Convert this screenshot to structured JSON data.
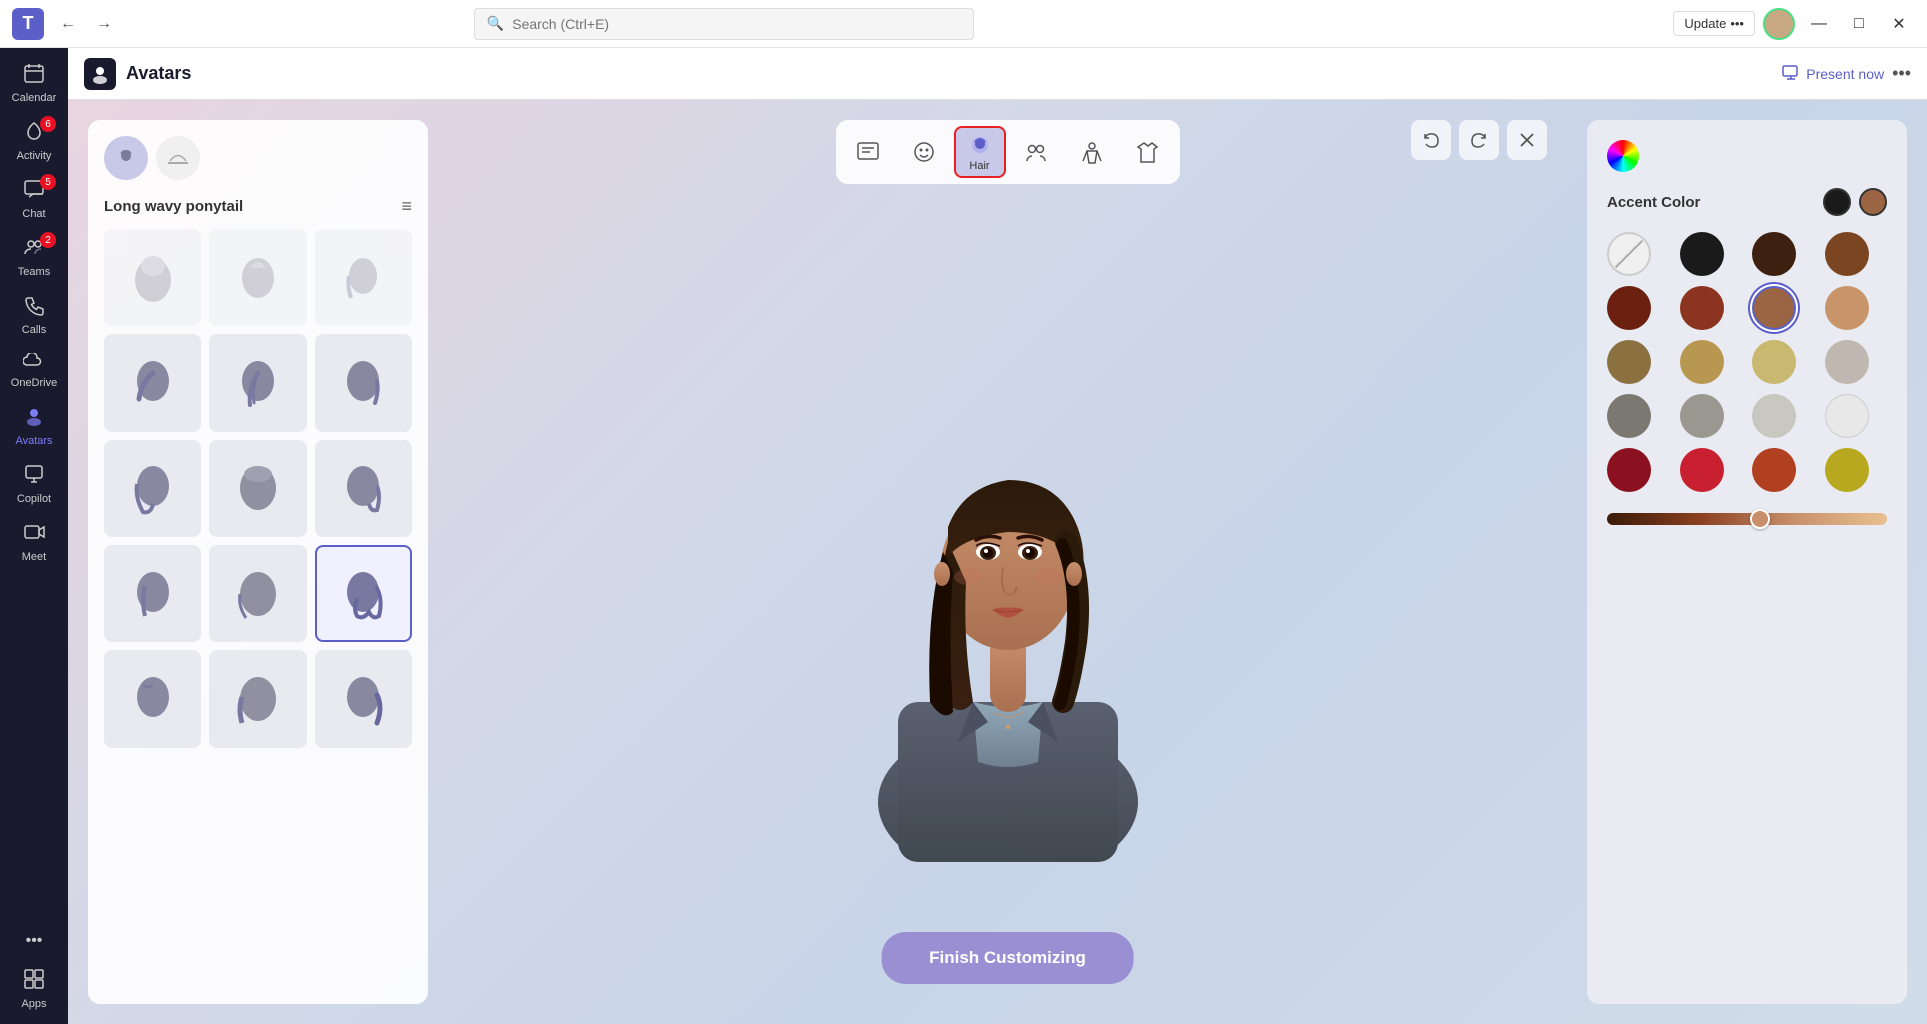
{
  "titlebar": {
    "app_icon": "🟦",
    "back_label": "←",
    "forward_label": "→",
    "search_placeholder": "Search (Ctrl+E)",
    "update_label": "Update",
    "update_dots": "•••",
    "minimize_label": "—",
    "maximize_label": "□",
    "close_label": "✕"
  },
  "sidebar": {
    "items": [
      {
        "id": "calendar",
        "label": "Calendar",
        "icon": "📅",
        "badge": null,
        "active": false
      },
      {
        "id": "activity",
        "label": "Activity",
        "icon": "🔔",
        "badge": "6",
        "active": false
      },
      {
        "id": "chat",
        "label": "Chat",
        "icon": "💬",
        "badge": "5",
        "active": false
      },
      {
        "id": "teams",
        "label": "Teams",
        "icon": "👥",
        "badge": "2",
        "active": false
      },
      {
        "id": "calls",
        "label": "Calls",
        "icon": "📞",
        "badge": null,
        "active": false
      },
      {
        "id": "onedrive",
        "label": "OneDrive",
        "icon": "☁",
        "badge": null,
        "active": false
      },
      {
        "id": "avatars",
        "label": "Avatars",
        "icon": "🧑",
        "badge": null,
        "active": true
      },
      {
        "id": "copilot",
        "label": "Copilot",
        "icon": "🤖",
        "badge": null,
        "active": false
      },
      {
        "id": "meet",
        "label": "Meet",
        "icon": "📹",
        "badge": null,
        "active": false
      },
      {
        "id": "more",
        "label": "•••",
        "icon": "•••",
        "badge": null,
        "active": false
      },
      {
        "id": "apps",
        "label": "Apps",
        "icon": "⊞",
        "badge": null,
        "active": false
      }
    ]
  },
  "page_header": {
    "icon": "🧑",
    "title": "Avatars",
    "present_now_label": "Present now",
    "more_label": "•••"
  },
  "toolbar": {
    "buttons": [
      {
        "id": "reactions",
        "icon": "📋",
        "label": "",
        "active": false
      },
      {
        "id": "face",
        "icon": "😊",
        "label": "",
        "active": false
      },
      {
        "id": "hair",
        "icon": "🧑",
        "label": "Hair",
        "active": true,
        "selected": true
      },
      {
        "id": "groups",
        "icon": "👥",
        "label": "",
        "active": false
      },
      {
        "id": "body",
        "icon": "🤸",
        "label": "",
        "active": false
      },
      {
        "id": "clothes",
        "icon": "👕",
        "label": "",
        "active": false
      }
    ]
  },
  "controls": {
    "undo_label": "↩",
    "redo_label": "↪",
    "close_label": "✕"
  },
  "hair_panel": {
    "tabs": [
      {
        "id": "hair-style",
        "icon": "🧑",
        "active": true
      },
      {
        "id": "hat",
        "icon": "🎩",
        "active": false
      }
    ],
    "title": "Long wavy ponytail",
    "filter_icon": "≡",
    "styles": [
      {
        "id": 1,
        "selected": false,
        "row": 0
      },
      {
        "id": 2,
        "selected": false,
        "row": 0
      },
      {
        "id": 3,
        "selected": false,
        "row": 0
      },
      {
        "id": 4,
        "selected": false,
        "row": 1
      },
      {
        "id": 5,
        "selected": false,
        "row": 1
      },
      {
        "id": 6,
        "selected": false,
        "row": 1
      },
      {
        "id": 7,
        "selected": false,
        "row": 2
      },
      {
        "id": 8,
        "selected": false,
        "row": 2
      },
      {
        "id": 9,
        "selected": false,
        "row": 2
      },
      {
        "id": 10,
        "selected": true,
        "row": 3
      },
      {
        "id": 11,
        "selected": false,
        "row": 3
      },
      {
        "id": 12,
        "selected": false,
        "row": 3
      },
      {
        "id": 13,
        "selected": false,
        "row": 4
      },
      {
        "id": 14,
        "selected": false,
        "row": 4
      },
      {
        "id": 15,
        "selected": false,
        "row": 4
      }
    ]
  },
  "color_panel": {
    "accent_color_label": "Accent Color",
    "selected_colors": [
      "#1a1a1a",
      "#8b6543"
    ],
    "colors": [
      {
        "id": "none",
        "hex": null,
        "selected": false
      },
      {
        "id": "black",
        "hex": "#1a1a1a",
        "selected": false
      },
      {
        "id": "dark-brown",
        "hex": "#3d2010",
        "selected": false
      },
      {
        "id": "brown",
        "hex": "#7a4520",
        "selected": false
      },
      {
        "id": "dark-auburn",
        "hex": "#6b2010",
        "selected": false
      },
      {
        "id": "auburn",
        "hex": "#8b3520",
        "selected": false
      },
      {
        "id": "medium-brown",
        "hex": "#9b6543",
        "selected": true
      },
      {
        "id": "tan",
        "hex": "#c8956a",
        "selected": false
      },
      {
        "id": "dark-gold",
        "hex": "#8b7040",
        "selected": false
      },
      {
        "id": "gold",
        "hex": "#b89850",
        "selected": false
      },
      {
        "id": "light-gold",
        "hex": "#c8b870",
        "selected": false
      },
      {
        "id": "silver-gray",
        "hex": "#c0b8b0",
        "selected": false
      },
      {
        "id": "dark-gray",
        "hex": "#7a7870",
        "selected": false
      },
      {
        "id": "gray",
        "hex": "#9a9890",
        "selected": false
      },
      {
        "id": "light-gray",
        "hex": "#c8c8c0",
        "selected": false
      },
      {
        "id": "white",
        "hex": "#e8e8e8",
        "selected": false
      },
      {
        "id": "dark-red",
        "hex": "#8b1020",
        "selected": false
      },
      {
        "id": "red",
        "hex": "#c82030",
        "selected": false
      },
      {
        "id": "rust",
        "hex": "#b04020",
        "selected": false
      },
      {
        "id": "olive",
        "hex": "#b8a820",
        "selected": false
      }
    ],
    "slider_value": 55
  },
  "finish_button": {
    "label": "Finish Customizing"
  }
}
